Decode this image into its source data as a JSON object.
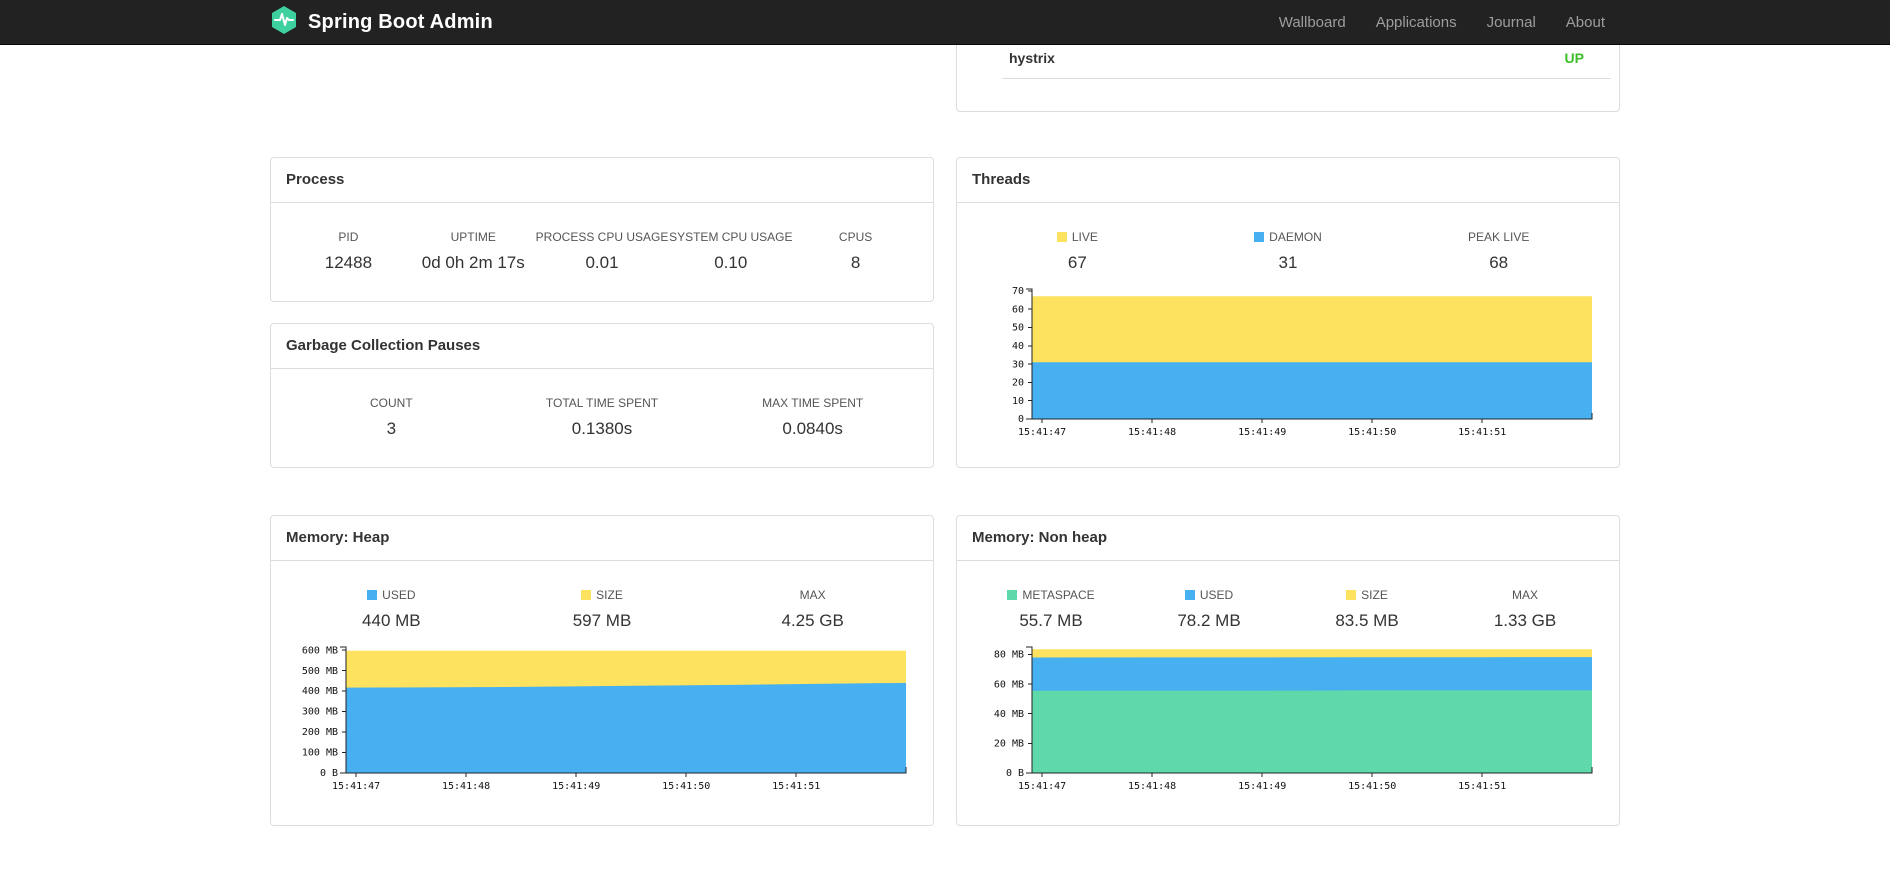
{
  "navbar": {
    "brand": "Spring Boot Admin",
    "items": [
      {
        "label": "Wallboard"
      },
      {
        "label": "Applications"
      },
      {
        "label": "Journal"
      },
      {
        "label": "About"
      }
    ]
  },
  "colors": {
    "blue": "#47b0f0",
    "yellow": "#fce25e",
    "green": "#5fd8aa",
    "status_up": "#3dbd2a",
    "navbar_bg": "#222222",
    "logo": "#3fd0a0"
  },
  "health": {
    "item": "hystrix",
    "status": "UP"
  },
  "panels": {
    "process": {
      "title": "Process",
      "metrics": [
        {
          "label": "PID",
          "value": "12488"
        },
        {
          "label": "UPTIME",
          "value": "0d 0h 2m 17s"
        },
        {
          "label": "PROCESS CPU USAGE",
          "value": "0.01"
        },
        {
          "label": "SYSTEM CPU USAGE",
          "value": "0.10"
        },
        {
          "label": "CPUS",
          "value": "8"
        }
      ]
    },
    "gc": {
      "title": "Garbage Collection Pauses",
      "metrics": [
        {
          "label": "COUNT",
          "value": "3"
        },
        {
          "label": "TOTAL TIME SPENT",
          "value": "0.1380s"
        },
        {
          "label": "MAX TIME SPENT",
          "value": "0.0840s"
        }
      ]
    },
    "threads": {
      "title": "Threads",
      "legend": [
        {
          "label": "LIVE",
          "value": "67",
          "swatch": "yellow"
        },
        {
          "label": "DAEMON",
          "value": "31",
          "swatch": "blue"
        },
        {
          "label": "PEAK LIVE",
          "value": "68"
        }
      ]
    },
    "memory_heap": {
      "title": "Memory: Heap",
      "legend": [
        {
          "label": "USED",
          "value": "440 MB",
          "swatch": "blue"
        },
        {
          "label": "SIZE",
          "value": "597 MB",
          "swatch": "yellow"
        },
        {
          "label": "MAX",
          "value": "4.25 GB"
        }
      ]
    },
    "memory_nonheap": {
      "title": "Memory: Non heap",
      "legend": [
        {
          "label": "METASPACE",
          "value": "55.7 MB",
          "swatch": "green"
        },
        {
          "label": "USED",
          "value": "78.2 MB",
          "swatch": "blue"
        },
        {
          "label": "SIZE",
          "value": "83.5 MB",
          "swatch": "yellow"
        },
        {
          "label": "MAX",
          "value": "1.33 GB"
        }
      ]
    }
  },
  "chart_data": [
    {
      "id": "threads",
      "type": "area",
      "stacked": true,
      "title": "Threads",
      "note": "series values are cumulative stack tops, bottom layer first",
      "x_tick_labels": [
        "15:41:47",
        "15:41:48",
        "15:41:49",
        "15:41:50",
        "15:41:51"
      ],
      "ylim": [
        0,
        71
      ],
      "y_ticks": [
        {
          "value": 0,
          "label": "0"
        },
        {
          "value": 10,
          "label": "10"
        },
        {
          "value": 20,
          "label": "20"
        },
        {
          "value": 30,
          "label": "30"
        },
        {
          "value": 40,
          "label": "40"
        },
        {
          "value": 50,
          "label": "50"
        },
        {
          "value": 60,
          "label": "60"
        },
        {
          "value": 70,
          "label": "70"
        }
      ],
      "series": [
        {
          "name": "DAEMON",
          "swatch": "blue",
          "values": [
            31,
            31,
            31,
            31,
            31,
            31
          ]
        },
        {
          "name": "LIVE",
          "swatch": "yellow",
          "values": [
            67,
            67,
            67,
            67,
            67,
            67
          ]
        }
      ]
    },
    {
      "id": "memory_heap",
      "type": "area",
      "stacked": true,
      "title": "Memory: Heap",
      "note": "series values are cumulative stack tops in MB, bottom layer first",
      "x_tick_labels": [
        "15:41:47",
        "15:41:48",
        "15:41:49",
        "15:41:50",
        "15:41:51"
      ],
      "ylim": [
        0,
        615
      ],
      "y_ticks": [
        {
          "value": 0,
          "label": "0 B"
        },
        {
          "value": 100,
          "label": "100 MB"
        },
        {
          "value": 200,
          "label": "200 MB"
        },
        {
          "value": 300,
          "label": "300 MB"
        },
        {
          "value": 400,
          "label": "400 MB"
        },
        {
          "value": 500,
          "label": "500 MB"
        },
        {
          "value": 600,
          "label": "600 MB"
        }
      ],
      "series": [
        {
          "name": "USED",
          "swatch": "blue",
          "values": [
            417,
            418,
            420,
            423,
            427,
            431,
            436,
            440
          ]
        },
        {
          "name": "SIZE",
          "swatch": "yellow",
          "values": [
            597,
            597,
            597,
            597,
            597,
            597,
            597,
            597
          ]
        }
      ]
    },
    {
      "id": "memory_nonheap",
      "type": "area",
      "stacked": true,
      "title": "Memory: Non heap",
      "note": "series values are cumulative stack tops in MB, bottom layer first",
      "x_tick_labels": [
        "15:41:47",
        "15:41:48",
        "15:41:49",
        "15:41:50",
        "15:41:51"
      ],
      "ylim": [
        0,
        85
      ],
      "y_ticks": [
        {
          "value": 0,
          "label": "0 B"
        },
        {
          "value": 20,
          "label": "20 MB"
        },
        {
          "value": 40,
          "label": "40 MB"
        },
        {
          "value": 60,
          "label": "60 MB"
        },
        {
          "value": 80,
          "label": "80 MB"
        }
      ],
      "series": [
        {
          "name": "METASPACE",
          "swatch": "green",
          "values": [
            55.5,
            55.6,
            55.6,
            55.7,
            55.7,
            55.7
          ]
        },
        {
          "name": "USED",
          "swatch": "blue",
          "values": [
            77.9,
            78.0,
            78.0,
            78.1,
            78.1,
            78.2
          ]
        },
        {
          "name": "SIZE",
          "swatch": "yellow",
          "values": [
            83.5,
            83.5,
            83.5,
            83.5,
            83.5,
            83.5
          ]
        }
      ]
    }
  ]
}
